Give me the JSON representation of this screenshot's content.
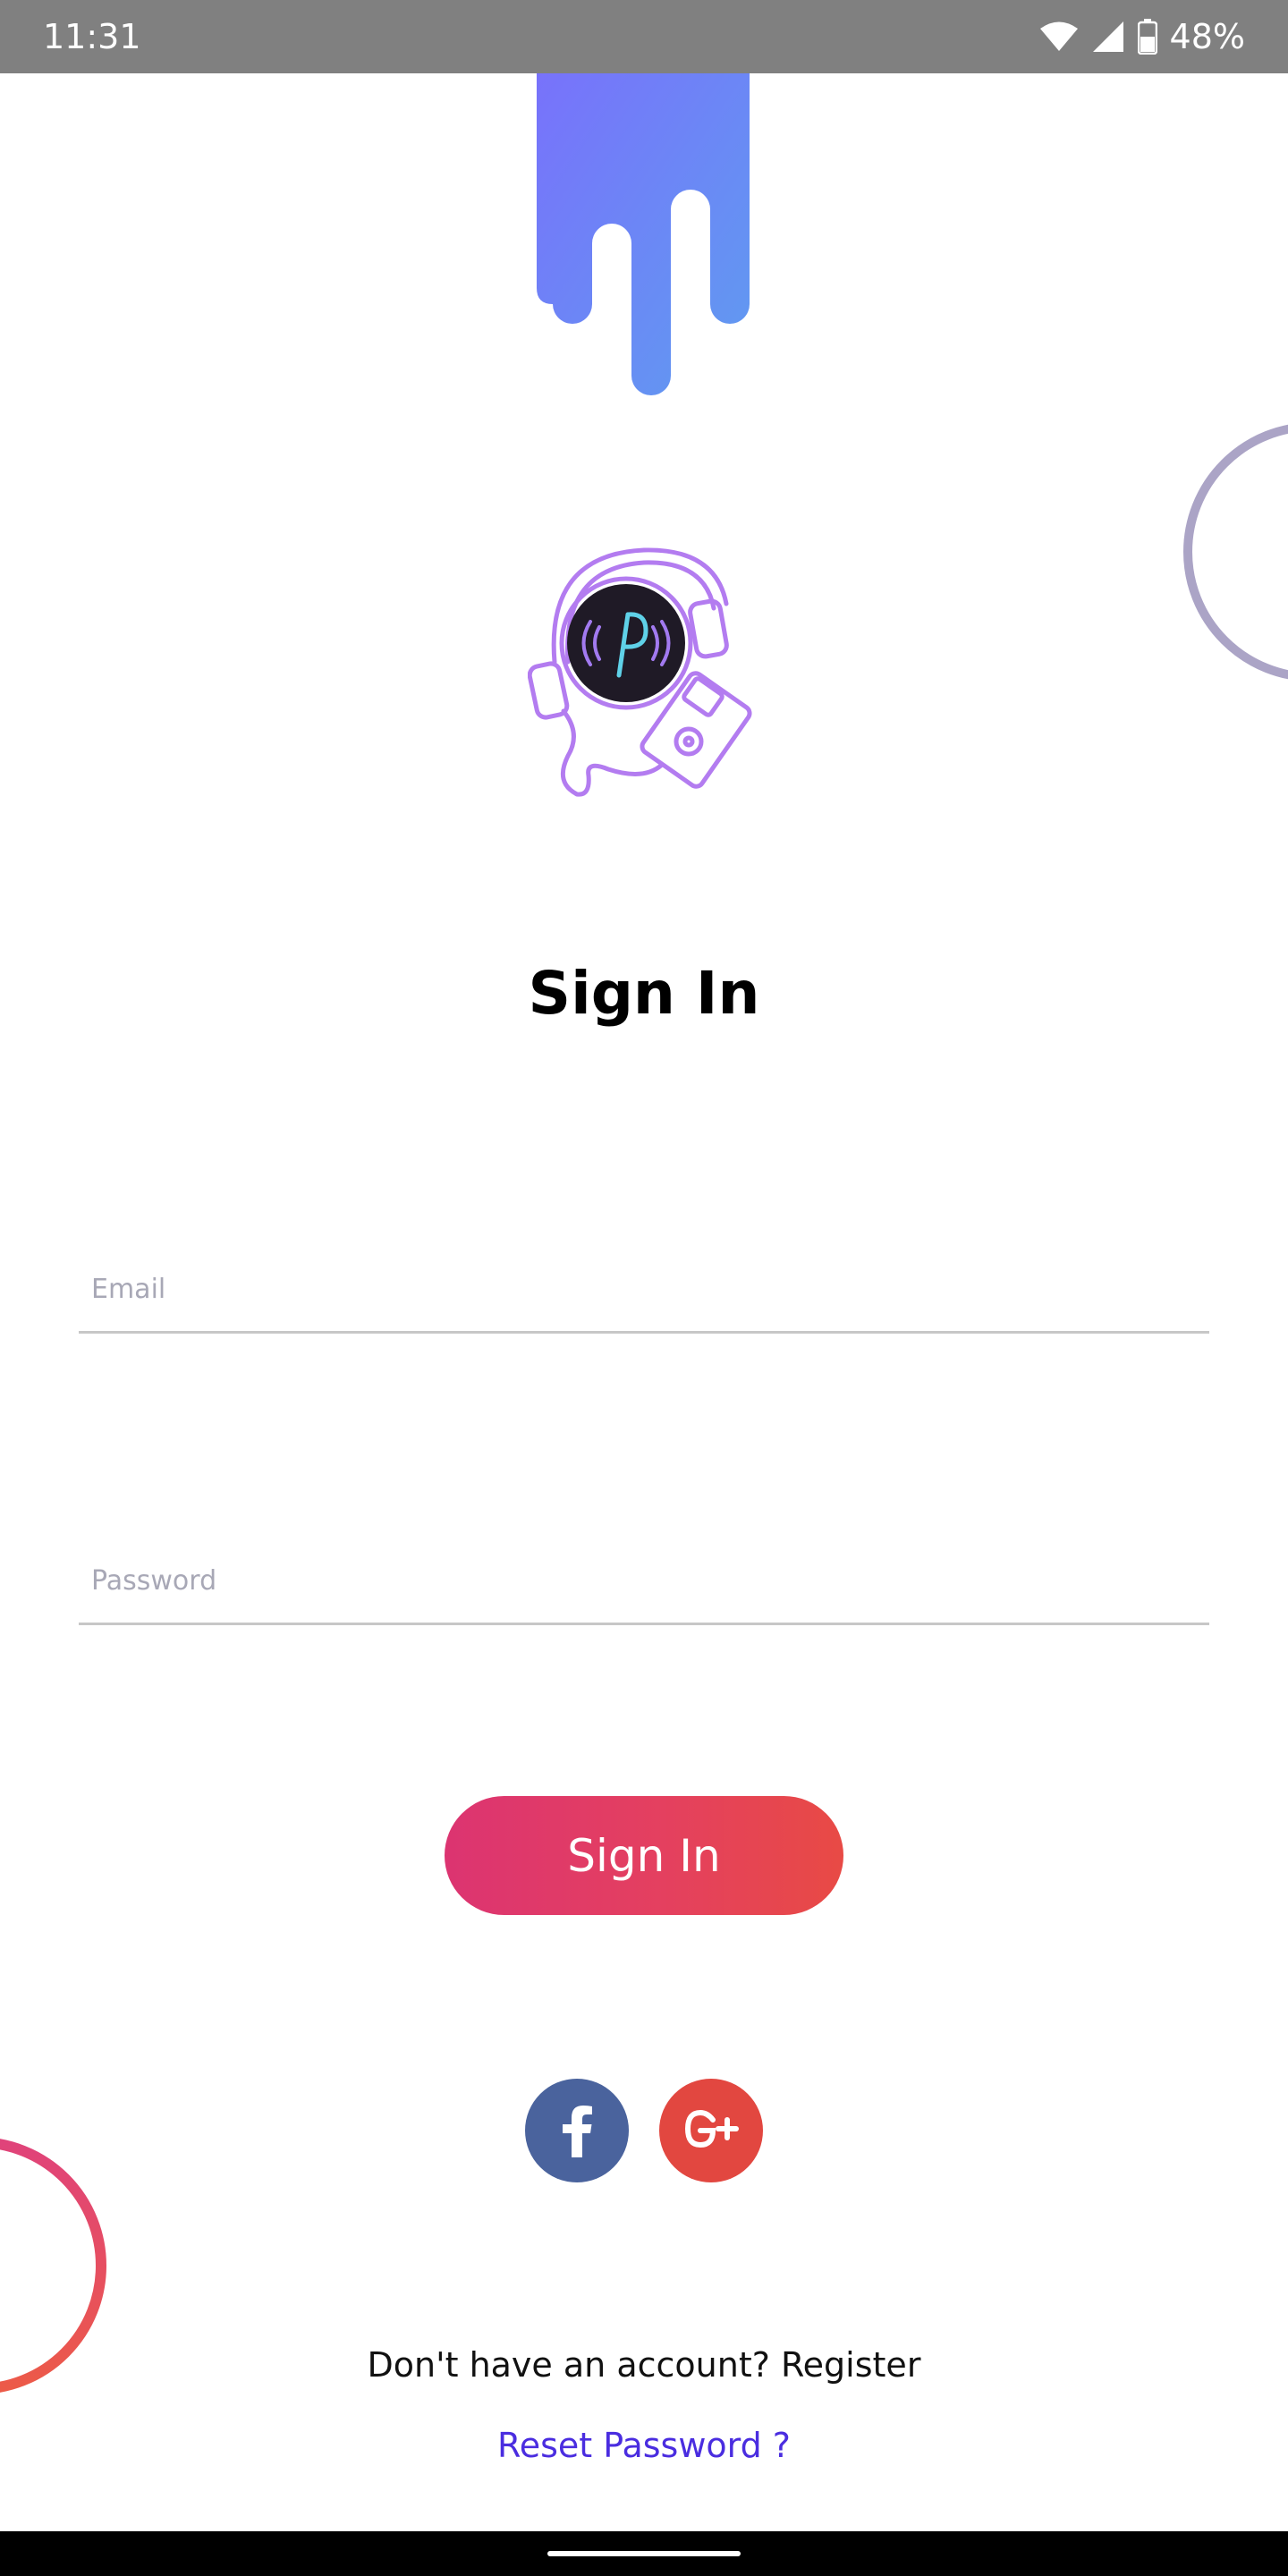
{
  "status_bar": {
    "time": "11:31",
    "battery": "48%",
    "icons": [
      "wifi-icon",
      "signal-icon",
      "battery-icon"
    ]
  },
  "screen": {
    "title": "Sign In",
    "email_placeholder": "Email",
    "password_placeholder": "Password",
    "submit_label": "Sign In",
    "social": [
      "facebook-icon",
      "google-plus-icon"
    ],
    "register_prompt": "Don't have an account?",
    "register_label": "Register",
    "reset_label": "Reset Password ?"
  },
  "colors": {
    "accent": "#4a2de0",
    "button_gradient_start": "#dc3471",
    "button_gradient_end": "#e84a45",
    "facebook": "#4a639d",
    "google": "#e24740",
    "drip_start": "#7872fb",
    "drip_end": "#5f9cf0",
    "logo_stroke": "#b37cf0"
  }
}
